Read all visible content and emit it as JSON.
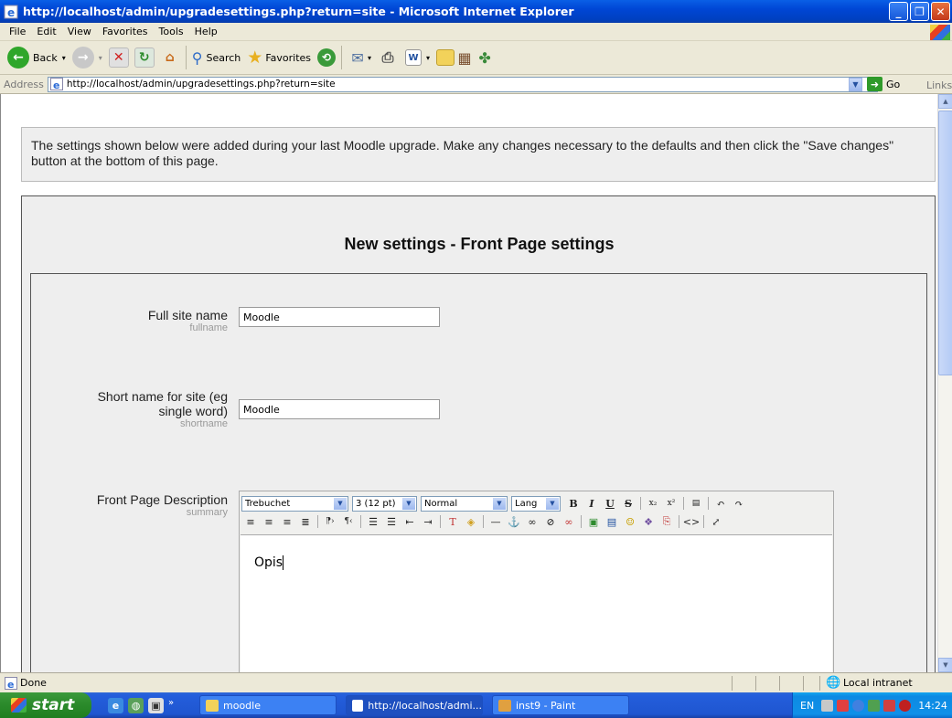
{
  "window": {
    "title": "http://localhost/admin/upgradesettings.php?return=site - Microsoft Internet Explorer",
    "controls": [
      "minimize-icon",
      "maximize-icon",
      "close-icon"
    ]
  },
  "menubar": {
    "items": [
      "File",
      "Edit",
      "View",
      "Favorites",
      "Tools",
      "Help"
    ]
  },
  "toolbar": {
    "back_label": "Back",
    "search_label": "Search",
    "favorites_label": "Favorites"
  },
  "address": {
    "label": "Address",
    "url": "http://localhost/admin/upgradesettings.php?return=site",
    "go_label": "Go",
    "links_label": "Links"
  },
  "page": {
    "notice": "The settings shown below were added during your last Moodle upgrade. Make any changes necessary to the defaults and then click the \"Save changes\" button at the bottom of this page.",
    "heading": "New settings - Front Page settings",
    "fields": [
      {
        "label": "Full site name",
        "name": "fullname",
        "value": "Moodle"
      },
      {
        "label": "Short name for site (eg single word)",
        "name": "shortname",
        "value": "Moodle"
      },
      {
        "label": "Front Page Description",
        "name": "summary",
        "value": "Opis"
      }
    ]
  },
  "editor": {
    "font": "Trebuchet",
    "size": "3 (12 pt)",
    "format": "Normal",
    "lang": "Lang",
    "content": "Opis"
  },
  "statusbar": {
    "status": "Done",
    "zone": "Local intranet"
  },
  "taskbar": {
    "start_label": "start",
    "tasks": [
      "moodle",
      "http://localhost/admi...",
      "inst9 - Paint"
    ],
    "lang": "EN",
    "clock": "14:24"
  },
  "colors": {
    "title_bar": "#0046D5",
    "taskbar": "#245EDC",
    "start_button": "#2D8C2D",
    "page_box_bg": "#EEEEEE"
  }
}
